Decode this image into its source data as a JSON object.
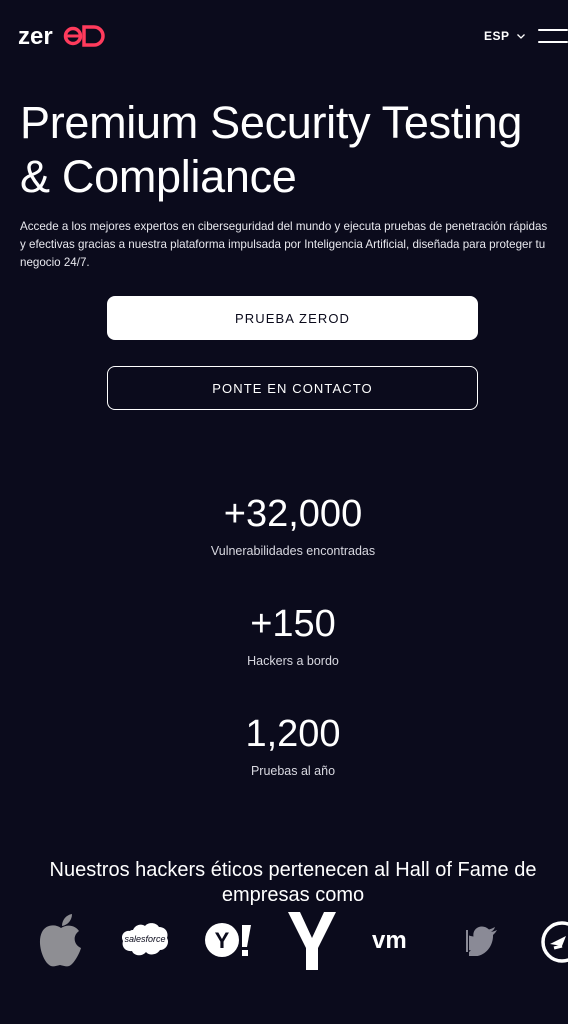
{
  "header": {
    "logo_text": "zerod",
    "language_label": "ESP"
  },
  "hero": {
    "title": "Premium Security Testing & Compliance",
    "description": "Accede a los mejores expertos en ciberseguridad del mundo y ejecuta pruebas de penetración rápidas y efectivas gracias a nuestra plataforma impulsada por Inteligencia Artificial, diseñada para proteger tu negocio 24/7.",
    "primary_button": "PRUEBA ZEROD",
    "secondary_button": "PONTE EN CONTACTO"
  },
  "stats": [
    {
      "value": "+32,000",
      "label": "Vulnerabilidades encontradas"
    },
    {
      "value": "+150",
      "label": "Hackers a bordo"
    },
    {
      "value": "1,200",
      "label": "Pruebas al año"
    }
  ],
  "hall_of_fame": {
    "title": "Nuestros hackers éticos pertenecen al Hall of Fame de empresas como",
    "logos": [
      {
        "name": "apple-logo"
      },
      {
        "name": "salesforce-logo",
        "text": "salesforce"
      },
      {
        "name": "yahoo-logo",
        "text": "Y!"
      },
      {
        "name": "ycombinator-logo",
        "text": "Y"
      },
      {
        "name": "vmware-logo",
        "text": "vm"
      },
      {
        "name": "twitter-logo"
      },
      {
        "name": "partial-logo"
      }
    ]
  },
  "colors": {
    "background": "#0b0b1c",
    "accent": "#ff3b5c",
    "text": "#ffffff"
  }
}
